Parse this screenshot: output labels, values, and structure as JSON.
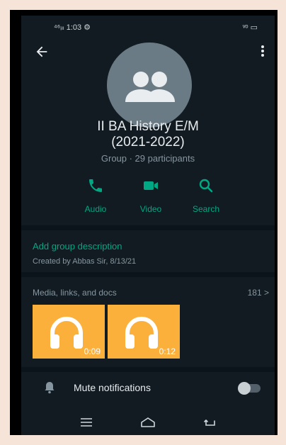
{
  "status_bar": {
    "left": "⁴⁶ᵢₗₗ 1:03 ⚙",
    "right": "ᵛᵒ ▭"
  },
  "group": {
    "name_line1": "II BA History E/M",
    "name_line2": "(2021-2022)",
    "subtitle": "Group · 29 participants"
  },
  "actions": [
    {
      "label": "Audio"
    },
    {
      "label": "Video"
    },
    {
      "label": "Search"
    }
  ],
  "description": {
    "add_link": "Add group description",
    "created_by": "Created by Abbas Sir, 8/13/21"
  },
  "media": {
    "title": "Media, links, and docs",
    "count": "181 >",
    "items": [
      {
        "duration": "0:09"
      },
      {
        "duration": "0:12"
      }
    ]
  },
  "notifications": {
    "mute_label": "Mute notifications",
    "mute_enabled": false
  },
  "colors": {
    "accent": "#00a884",
    "background": "#111b21",
    "tile": "#fbb03b"
  }
}
